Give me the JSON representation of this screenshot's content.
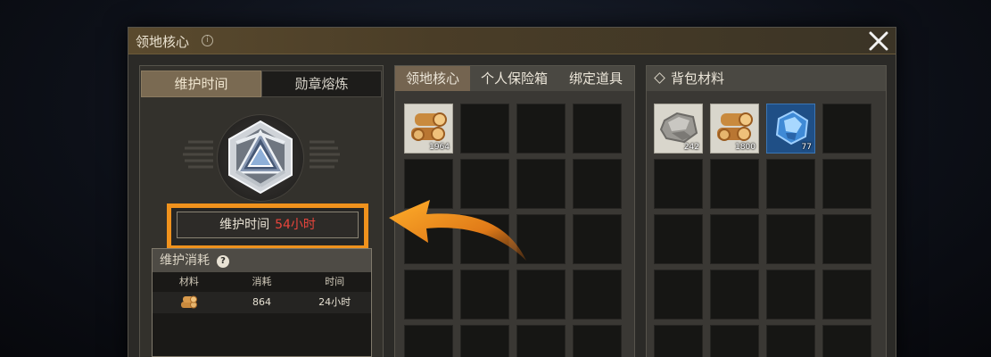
{
  "window": {
    "title": "领地核心"
  },
  "left_tabs": [
    "维护时间",
    "勋章熔炼"
  ],
  "maintain": {
    "label": "维护时间",
    "value": "54小时"
  },
  "consume": {
    "title": "维护消耗",
    "columns": [
      "材料",
      "消耗",
      "时间"
    ],
    "rows": [
      {
        "material_icon": "wood-logs-icon",
        "amount": "864",
        "time": "24小时"
      }
    ]
  },
  "mid_tabs": [
    "领地核心",
    "个人保险箱",
    "绑定道具"
  ],
  "mid_items": [
    {
      "icon": "wood-logs-icon",
      "qty": "1964"
    }
  ],
  "right_header": "背包材料",
  "right_items": [
    {
      "icon": "stone-icon",
      "qty": "242"
    },
    {
      "icon": "wood-logs-icon",
      "qty": "1800"
    },
    {
      "icon": "crystal-icon",
      "qty": "77"
    }
  ],
  "colors": {
    "highlight": "#f0921d",
    "time_value": "#e8453c",
    "active_tab": "#7a6a52"
  }
}
